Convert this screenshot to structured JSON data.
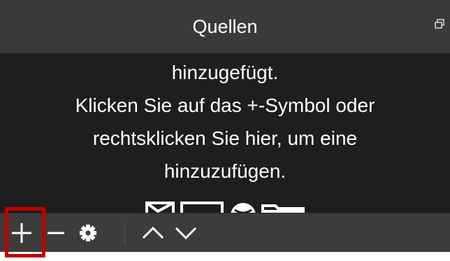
{
  "dock": {
    "title": "Quellen",
    "float_icon": "float-dock-icon"
  },
  "sources_empty": {
    "lines": [
      "hinzugefügt.",
      "Klicken Sie auf das +-Symbol oder",
      "rechtsklicken Sie hier, um eine",
      "hinzuzufügen."
    ],
    "hint_icons": [
      "image-icon",
      "display-icon",
      "globe-icon",
      "folder-icon"
    ]
  },
  "toolbar": {
    "buttons": [
      {
        "name": "add-source",
        "icon": "plus-icon"
      },
      {
        "name": "remove-source",
        "icon": "minus-icon"
      },
      {
        "name": "source-properties",
        "icon": "gear-icon"
      },
      {
        "name": "move-up",
        "icon": "chevron-up-icon"
      },
      {
        "name": "move-down",
        "icon": "chevron-down-icon"
      }
    ],
    "highlight_color": "#c00000"
  },
  "colors": {
    "titlebar_bg": "#3a3a3a",
    "body_bg": "#1e1e1e",
    "toolbar_bg": "#3c3c3c",
    "text": "#ffffff"
  }
}
